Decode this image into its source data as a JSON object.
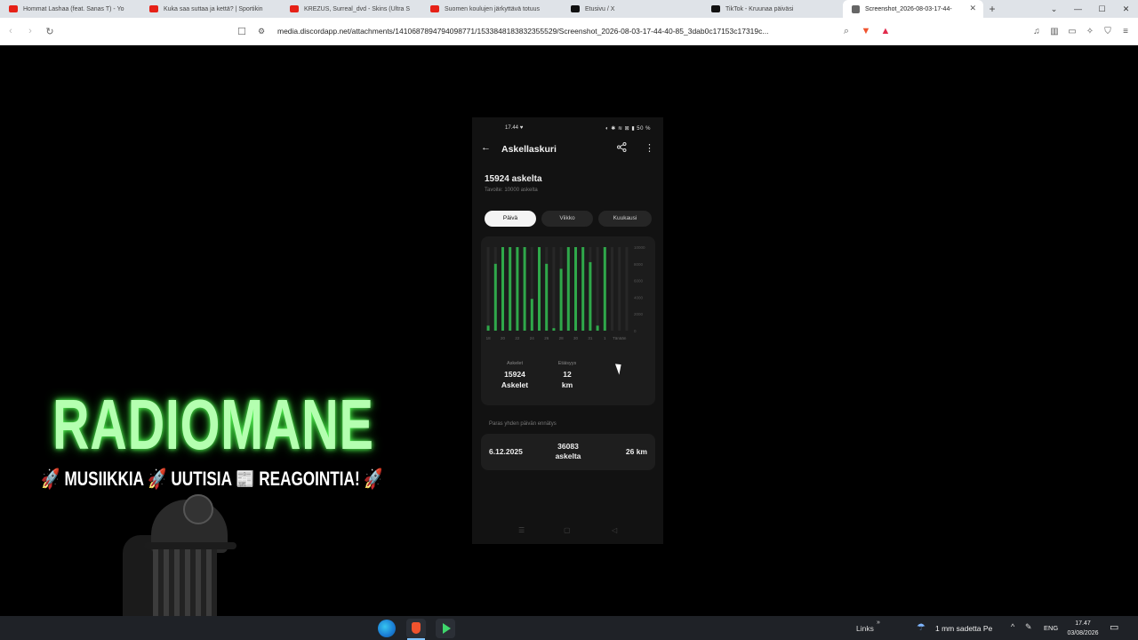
{
  "browser": {
    "tabs": [
      {
        "title": "Hommat Lashaa (feat. Sanas T) - Yo",
        "favicon": "youtube-icon",
        "active": false
      },
      {
        "title": "Kuka saa suttaa ja kettä? | Sportikin",
        "favicon": "youtube-icon",
        "active": false
      },
      {
        "title": "KREZUS, Surreal_dvd - Skins (Ultra S",
        "favicon": "youtube-icon",
        "active": false
      },
      {
        "title": "Suomen koulujen järkyttävä totuus",
        "favicon": "youtube-icon",
        "active": false
      },
      {
        "title": "Etusivu / X",
        "favicon": "x-icon",
        "active": false
      },
      {
        "title": "TikTok - Kruunaa päiväsi",
        "favicon": "tiktok-icon",
        "active": false
      },
      {
        "title": "Screenshot_2026-08-03-17-44-",
        "favicon": "globe-icon",
        "active": true
      }
    ],
    "new_tab": "+",
    "url": "media.discordapp.net/attachments/1410687894794098771/1533848183832355529/Screenshot_2026-08-03-17-44-40-85_3dab0c17153c17319c...",
    "window_controls": {
      "minimize": "—",
      "maximize": "☐",
      "close": "✕",
      "dropdown": "⌄"
    }
  },
  "phone": {
    "status": {
      "time": "17.44",
      "heart": "♥",
      "right": "◐ ✱ ≋ ⊠ ▮ 50 %"
    },
    "appbar": {
      "back": "←",
      "title": "Askellaskuri",
      "share": "⋖",
      "more": "⋮"
    },
    "steps_headline": "15924 askelta",
    "goal": "Tavoite: 10000 askelta",
    "segments": [
      "Päivä",
      "Viikko",
      "Kuukausi"
    ],
    "selected_segment": "Päivä",
    "chart_data": {
      "type": "bar",
      "categories": [
        "18",
        "",
        "20",
        "",
        "22",
        "",
        "24",
        "",
        "26",
        "",
        "28",
        "",
        "30",
        "",
        "31",
        "",
        "1",
        "",
        "Tänään",
        ""
      ],
      "x_tick_labels": [
        "18",
        "20",
        "22",
        "24",
        "26",
        "28",
        "30",
        "31",
        "1",
        "Tänään"
      ],
      "values": [
        600,
        8000,
        10000,
        10000,
        10000,
        10000,
        3800,
        10000,
        8000,
        300,
        7400,
        10000,
        10000,
        10000,
        8200,
        600,
        10000,
        0,
        0,
        0
      ],
      "ylim": [
        0,
        10000
      ],
      "y_tick_labels": [
        "10000",
        "8000",
        "6000",
        "4000",
        "2000",
        "0"
      ],
      "colors": {
        "bar": "#2fa84a",
        "track": "#272727"
      }
    },
    "stats": {
      "steps_label": "Askelet",
      "steps_value": "15924",
      "steps_unit": "Askelet",
      "distance_label": "Etäisyys",
      "distance_value": "12",
      "distance_unit": "km"
    },
    "best_label": "Paras yhden päivän ennätys",
    "best": {
      "date": "6.12.2025",
      "steps_value": "36083",
      "steps_unit": "askelta",
      "distance": "26 km"
    },
    "navbar": {
      "menu": "☰",
      "home": "▢",
      "back": "◁"
    }
  },
  "overlay": {
    "title": "RADIOMANE",
    "tagline": "🚀 MUSIIKKIA 🚀 UUTISIA 📰 REAGOINTIA! 🚀",
    "title_color": "#b4ffb0"
  },
  "taskbar": {
    "links": "Links",
    "links_chevron": "»",
    "weather": "1 mm sadetta Pe",
    "tray_icons": [
      "^",
      "✎",
      "☁"
    ],
    "language": "ENG",
    "time": "17.47",
    "date": "03/08/2026",
    "notification": "🗨"
  }
}
